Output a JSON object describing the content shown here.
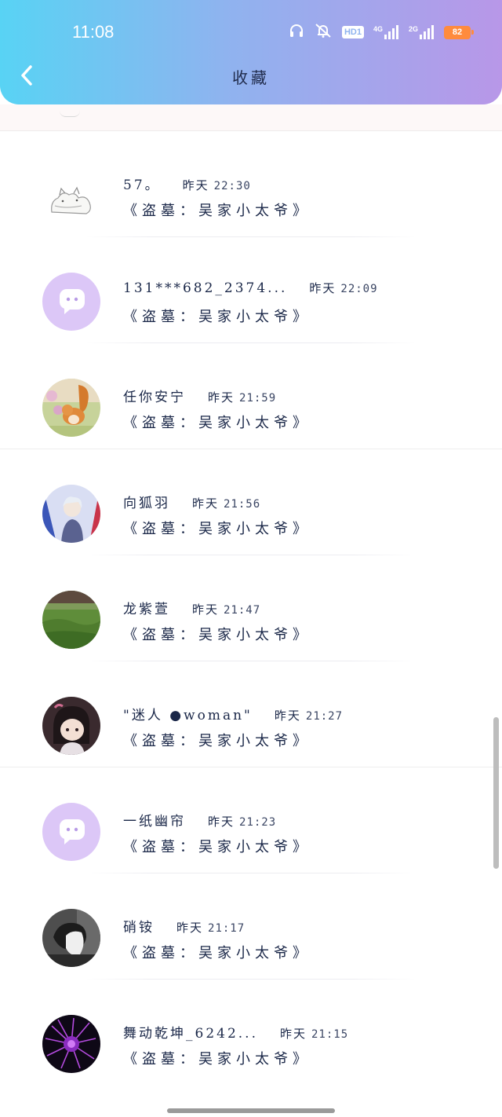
{
  "status_bar": {
    "time": "11:08",
    "battery": "82",
    "network_4g": "4G",
    "network_2g": "2G",
    "hd_badge": "HD1"
  },
  "header": {
    "title": "收藏",
    "back_icon": "chevron-left-icon",
    "gradient": [
      "#58d3f4",
      "#b897e8"
    ]
  },
  "entries": [
    {
      "name": "57。",
      "date": "昨天",
      "time": "22:30",
      "title": "《盗墓：吴家小太爷》",
      "avatar": "cat-sketch"
    },
    {
      "name": "131***682_2374...",
      "date": "昨天",
      "time": "22:09",
      "title": "《盗墓：吴家小太爷》",
      "avatar": "default-chat"
    },
    {
      "name": "任你安宁",
      "date": "昨天",
      "time": "21:59",
      "title": "《盗墓：吴家小太爷》",
      "avatar": "squirrel"
    },
    {
      "name": "向狐羽",
      "date": "昨天",
      "time": "21:56",
      "title": "《盗墓：吴家小太爷》",
      "avatar": "anime-boy"
    },
    {
      "name": "龙紫萱",
      "date": "昨天",
      "time": "21:47",
      "title": "《盗墓：吴家小太爷》",
      "avatar": "grass-field"
    },
    {
      "name": "\"迷人 ●woman\"",
      "date": "昨天",
      "time": "21:27",
      "title": "《盗墓：吴家小太爷》",
      "avatar": "chibi-character"
    },
    {
      "name": "一纸幽帘",
      "date": "昨天",
      "time": "21:23",
      "title": "《盗墓：吴家小太爷》",
      "avatar": "default-chat"
    },
    {
      "name": "硝铵",
      "date": "昨天",
      "time": "21:17",
      "title": "《盗墓：吴家小太爷》",
      "avatar": "dark-photo"
    },
    {
      "name": "舞动乾坤_6242...",
      "date": "昨天",
      "time": "21:15",
      "title": "《盗墓：吴家小太爷》",
      "avatar": "purple-flower"
    }
  ],
  "colors": {
    "text": "#1a2748",
    "default_avatar": "#d9c4f6",
    "battery": "#ff8b3d"
  }
}
